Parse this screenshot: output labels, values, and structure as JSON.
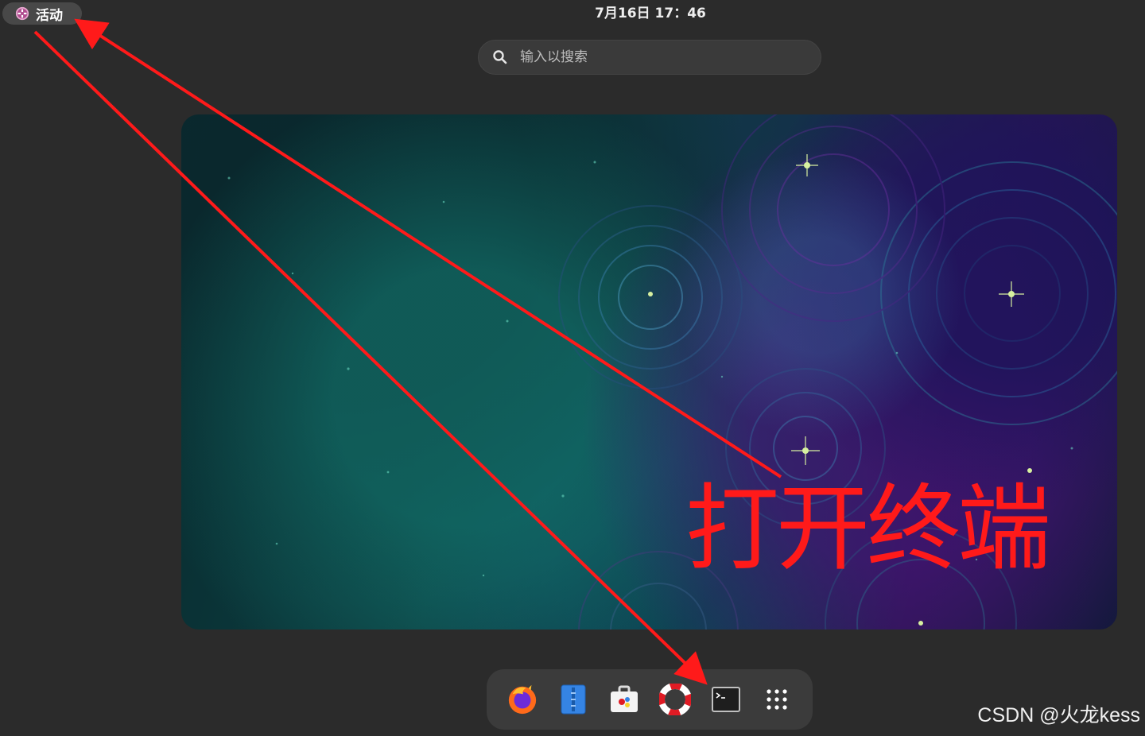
{
  "topbar": {
    "activities_label": "活动",
    "activities_icon": "fedora-logo-icon",
    "clock": "7月16日 17：46"
  },
  "search": {
    "placeholder": "输入以搜索",
    "icon": "search-icon"
  },
  "workspace": {
    "wallpaper": "starry-night-nebula"
  },
  "dock": {
    "items": [
      {
        "name": "firefox",
        "icon": "firefox-icon"
      },
      {
        "name": "files",
        "icon": "files-icon"
      },
      {
        "name": "software",
        "icon": "software-store-icon"
      },
      {
        "name": "help",
        "icon": "lifebuoy-icon"
      },
      {
        "name": "terminal",
        "icon": "terminal-icon"
      },
      {
        "name": "show-apps",
        "icon": "app-grid-icon"
      }
    ]
  },
  "annotation": {
    "callout_text": "打开终端",
    "color": "#ff1a1a"
  },
  "watermark": "CSDN @火龙kess"
}
